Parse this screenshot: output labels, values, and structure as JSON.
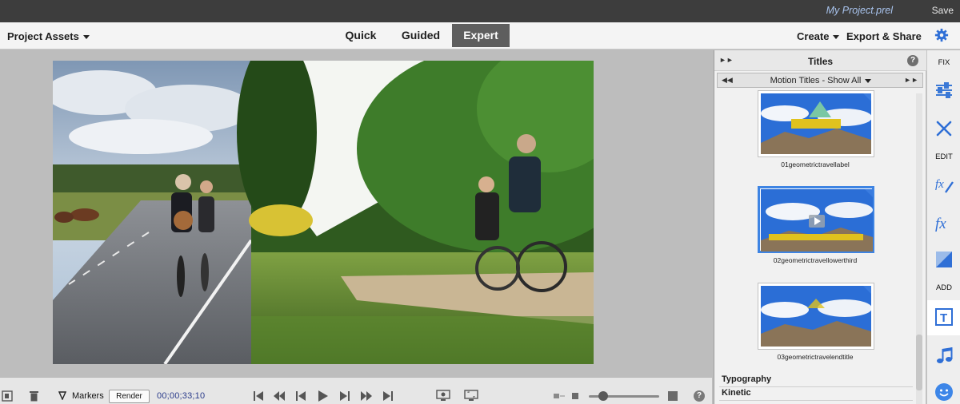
{
  "titlebar": {
    "project_name": "My Project.prel",
    "save_label": "Save"
  },
  "toolbar": {
    "project_assets_label": "Project Assets",
    "modes": [
      {
        "label": "Quick",
        "active": false
      },
      {
        "label": "Guided",
        "active": false
      },
      {
        "label": "Expert",
        "active": true
      }
    ],
    "create_label": "Create",
    "export_label": "Export & Share",
    "settings_icon": "gear-icon"
  },
  "transport": {
    "markers_label": "Markers",
    "render_label": "Render",
    "timecode": "00;00;33;10",
    "zoom_level": 0.2
  },
  "titles_panel": {
    "title": "Titles",
    "help_label": "?",
    "category": "Motion Titles - Show All",
    "items": [
      {
        "name": "01geometrictravellabel",
        "selected": false
      },
      {
        "name": "02geometrictravellowerthird",
        "selected": true
      },
      {
        "name": "03geometrictravelendtitle",
        "selected": false
      }
    ],
    "sections": [
      "Typography",
      "Kinetic"
    ]
  },
  "tools": {
    "categories": [
      "FIX",
      "EDIT",
      "ADD"
    ],
    "icons": [
      "adjust-sliders-icon",
      "tools-icon",
      "fx-edit-icon",
      "fx-icon",
      "color-icon",
      "text-icon",
      "music-icon",
      "face-icon"
    ]
  },
  "colors": {
    "accent": "#3e84e3",
    "active_tab": "#5e5e5e",
    "titlebar_bg": "#3d3d3d"
  }
}
